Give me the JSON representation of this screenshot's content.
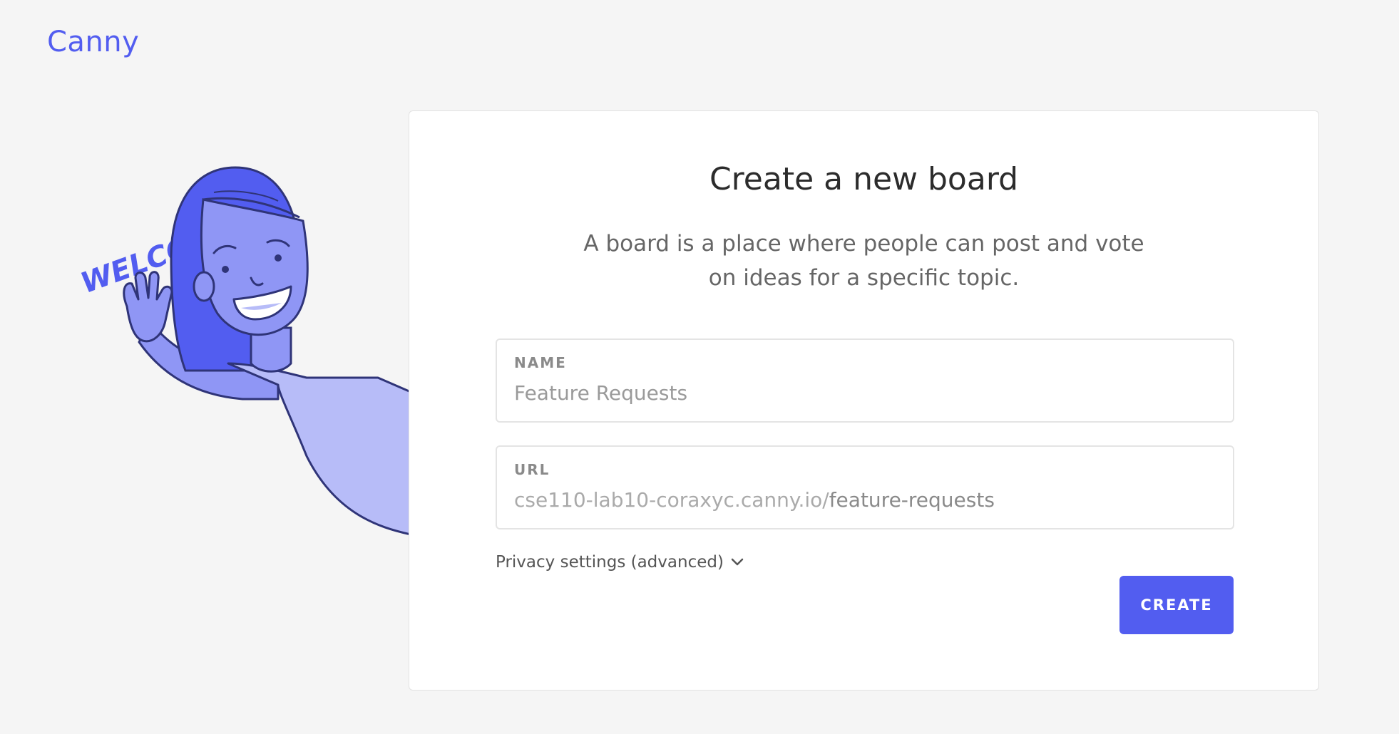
{
  "brand": {
    "logo_text": "Canny",
    "accent_color": "#525df0"
  },
  "illustration": {
    "welcome_text": "WELCOME!",
    "icon": "waving-person-illustration"
  },
  "card": {
    "title": "Create a new board",
    "description_line1": "A board is a place where people can post and vote",
    "description_line2": "on ideas for a specific topic."
  },
  "form": {
    "name_field": {
      "label": "NAME",
      "placeholder": "Feature Requests",
      "value": ""
    },
    "url_field": {
      "label": "URL",
      "prefix": "cse110-lab10-coraxyc.canny.io/",
      "slug": "feature-requests"
    },
    "privacy_toggle": {
      "label": "Privacy settings (advanced)",
      "icon": "chevron-down-icon"
    },
    "create_button": {
      "label": "CREATE"
    }
  }
}
